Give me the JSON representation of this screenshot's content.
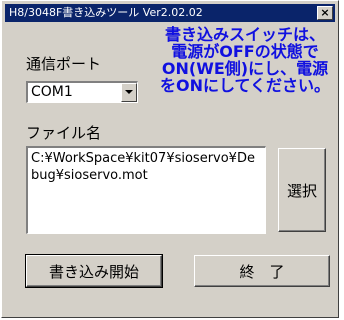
{
  "window": {
    "title": "H8/3048F書き込みツール Ver2.02.02",
    "close_symbol": "×"
  },
  "port": {
    "label": "通信ポート",
    "value": "COM1"
  },
  "notice": {
    "lines": [
      "書き込みスイッチは、",
      "電源がOFFの状態で",
      "ON(WE側)にし、電源",
      "をONにしてください。"
    ],
    "color": "#1010e0"
  },
  "file": {
    "label": "ファイル名",
    "path": "C:¥WorkSpace¥kit07¥sioservo¥Debug¥sioservo.mot"
  },
  "buttons": {
    "select": "選択",
    "start": "書き込み開始",
    "end": "終　了"
  },
  "colors": {
    "titlebar": "#0a246a",
    "face": "#d4d0c8"
  }
}
